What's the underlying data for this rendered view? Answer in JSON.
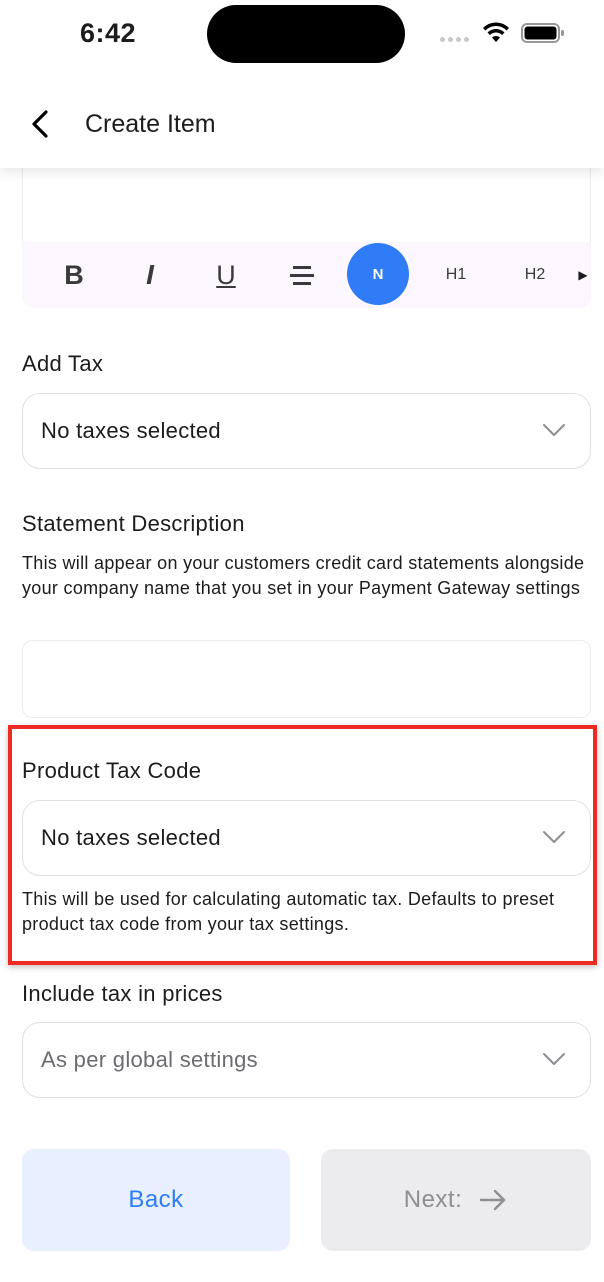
{
  "status_bar": {
    "time": "6:42"
  },
  "header": {
    "title": "Create Item",
    "back_icon": "chevron-left-icon"
  },
  "editor_toolbar": {
    "bold": "B",
    "italic": "I",
    "underline": "U",
    "normal": "N",
    "h1": "H1",
    "h2": "H2"
  },
  "add_tax": {
    "label": "Add Tax",
    "value": "No taxes selected"
  },
  "statement_description": {
    "label": "Statement Description",
    "help": "This will appear on your customers credit card statements alongside your company name that you set in your Payment Gateway settings",
    "value": ""
  },
  "product_tax_code": {
    "label": "Product Tax Code",
    "value": "No taxes selected",
    "help": "This will be used for calculating automatic tax. Defaults to preset product tax code from your tax settings."
  },
  "include_tax": {
    "label": "Include tax in prices",
    "value": "As per global settings"
  },
  "buttons": {
    "back": "Back",
    "next": "Next:"
  },
  "colors": {
    "accent": "#2f7cf6",
    "highlight": "#ee2a24",
    "back_bg": "#e8f0ff",
    "next_bg": "#ececee"
  }
}
